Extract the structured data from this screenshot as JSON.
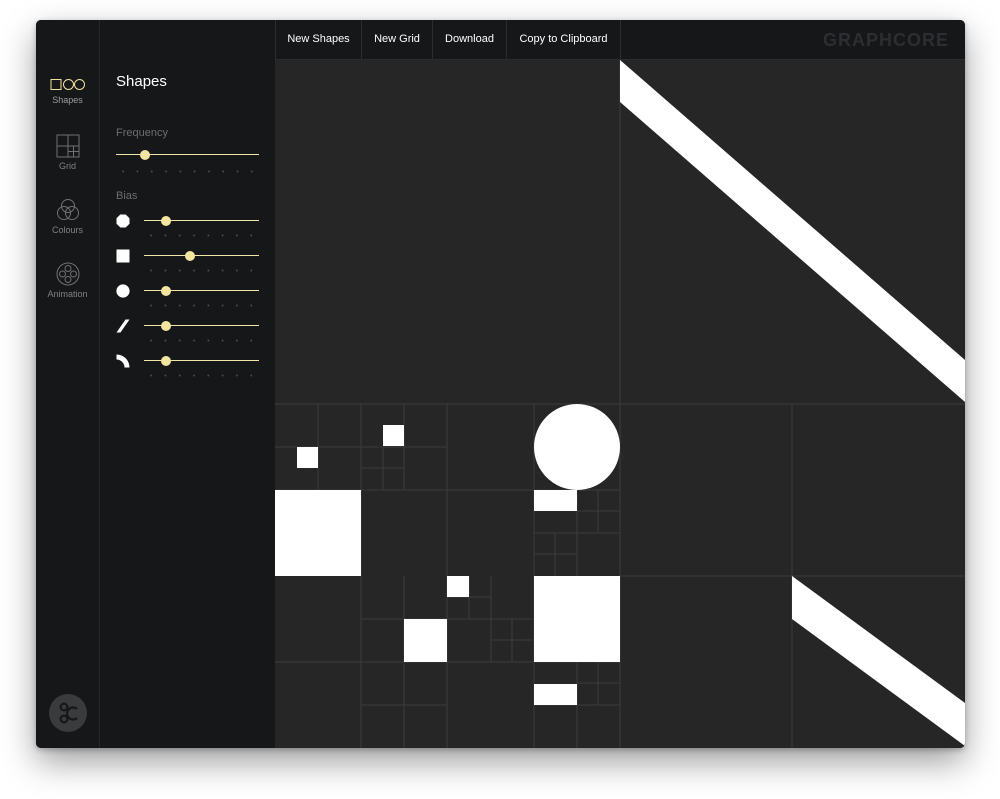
{
  "sidebar": {
    "nav_items": [
      {
        "id": "shapes",
        "label": "Shapes",
        "icon": "shapes-icon",
        "active": true
      },
      {
        "id": "grid",
        "label": "Grid",
        "icon": "grid-icon",
        "active": false
      },
      {
        "id": "colours",
        "label": "Colours",
        "icon": "colours-icon",
        "active": false
      },
      {
        "id": "animation",
        "label": "Animation",
        "icon": "animation-icon",
        "active": false
      }
    ],
    "logo_icon": "graphcore-badge-icon"
  },
  "panel": {
    "title": "Shapes",
    "frequency_label": "Frequency",
    "frequency_value": 0.2,
    "bias_label": "Bias",
    "bias": [
      {
        "shape": "circle-icon",
        "value": 0.19
      },
      {
        "shape": "square-icon",
        "value": 0.4
      },
      {
        "shape": "circle-icon",
        "value": 0.19
      },
      {
        "shape": "diagonal-line-icon",
        "value": 0.19
      },
      {
        "shape": "quarter-arc-icon",
        "value": 0.19
      }
    ]
  },
  "toolbar": {
    "new_shapes_label": "New Shapes",
    "new_grid_label": "New Grid",
    "download_label": "Download",
    "copy_label": "Copy to Clipboard",
    "brand": "GRAPHCORE"
  },
  "colors": {
    "accent": "#f3e5a0",
    "canvas_background": "#262626",
    "shape_fill": "#ffffff",
    "panel_background": "#161719"
  }
}
